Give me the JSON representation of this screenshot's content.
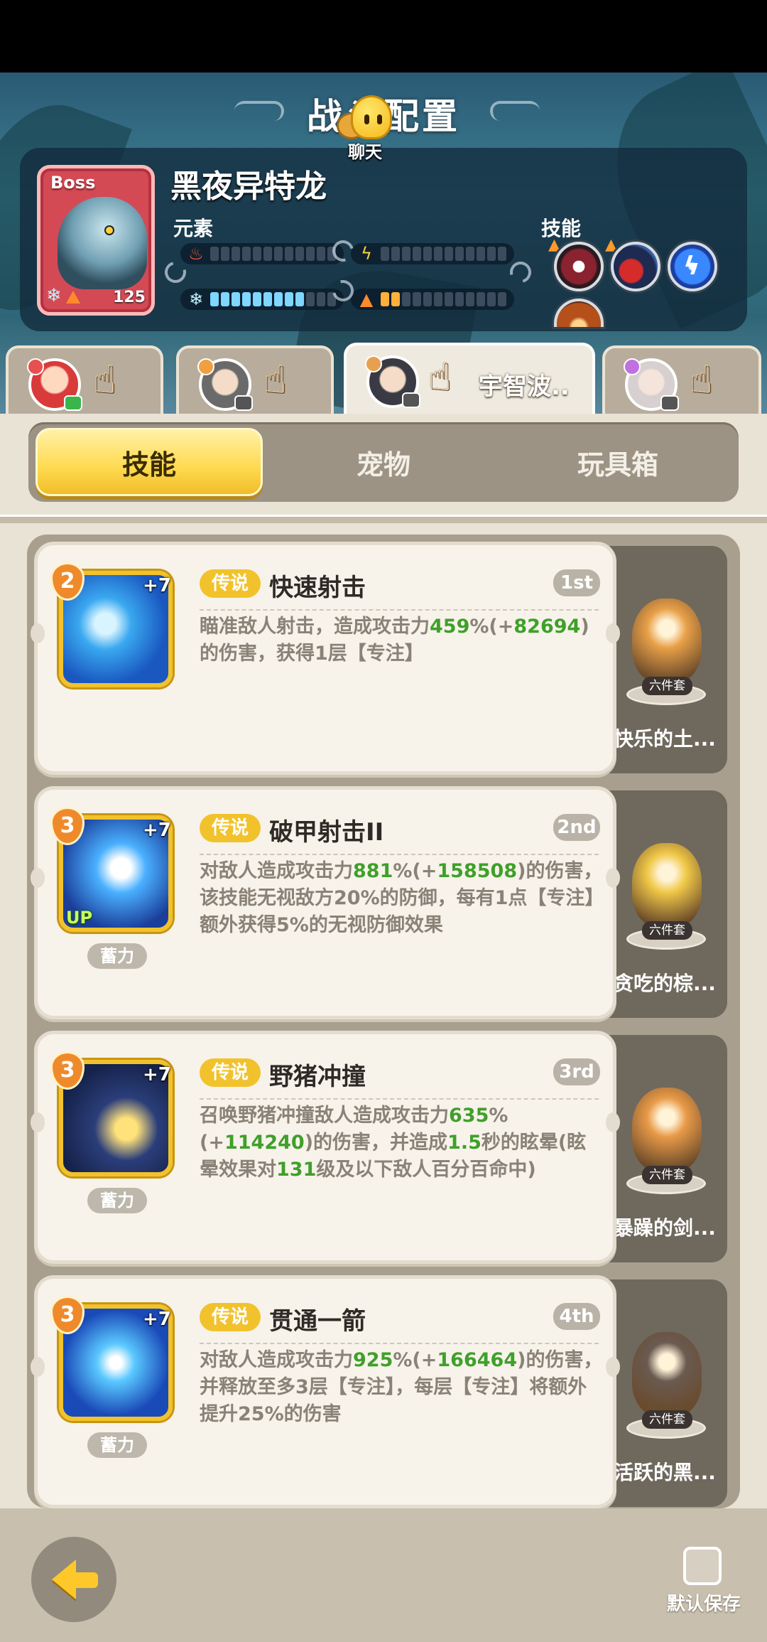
{
  "header": {
    "title": "战斗配置",
    "chat_label": "聊天"
  },
  "boss": {
    "tag": "Boss",
    "name": "黑夜异特龙",
    "level": "125",
    "element_label": "元素",
    "skill_label": "技能",
    "elements": [
      {
        "icon": "fire-icon",
        "color": "#ff5a3a",
        "filled": 0
      },
      {
        "icon": "lightning-icon",
        "color": "#ffd23a",
        "filled": 0
      },
      {
        "icon": "snowflake-icon",
        "color": "#bdf1ff",
        "filled": 9
      },
      {
        "icon": "earth-triangle-icon",
        "color": "#ff8a2a",
        "filled": 2
      }
    ],
    "skills": [
      "fanged-mouth-skill-icon",
      "red-bird-skill-icon",
      "lightning-orb-skill-icon",
      "fire-fan-skill-icon"
    ]
  },
  "team_tabs": [
    {
      "name": "",
      "active": false
    },
    {
      "name": "",
      "active": false
    },
    {
      "name": "宇智波..",
      "active": true
    },
    {
      "name": "",
      "active": false
    }
  ],
  "segments": {
    "skill": "技能",
    "pet": "宠物",
    "toybox": "玩具箱"
  },
  "skills": [
    {
      "level": "2",
      "plus": "+7",
      "rarity": "传说",
      "name": "快速射击",
      "order": "1st",
      "desc_parts": [
        "瞄准敌人射击，造成攻击力",
        "459",
        "%(+",
        "82694",
        ")的伤害，获得1层【专注】"
      ],
      "charge": "",
      "up": "",
      "pet": {
        "set": "六件套",
        "name": "快乐的土..."
      }
    },
    {
      "level": "3",
      "plus": "+7",
      "rarity": "传说",
      "name": "破甲射击II",
      "order": "2nd",
      "desc_parts": [
        "对敌人造成攻击力",
        "881",
        "%(+",
        "158508",
        ")的伤害，该技能无视敌方20%的防御，每有1点【专注】额外获得5%的无视防御效果"
      ],
      "charge": "蓄力",
      "up": "UP",
      "pet": {
        "set": "六件套",
        "name": "贪吃的棕..."
      }
    },
    {
      "level": "3",
      "plus": "+7",
      "rarity": "传说",
      "name": "野猪冲撞",
      "order": "3rd",
      "desc_parts": [
        "召唤野猪冲撞敌人造成攻击力",
        "635",
        "%(+",
        "114240",
        ")的伤害，并造成",
        "1.5",
        "秒的眩晕(眩晕效果对",
        "131",
        "级及以下敌人百分百命中)"
      ],
      "charge": "蓄力",
      "up": "",
      "pet": {
        "set": "六件套",
        "name": "暴躁的剑..."
      }
    },
    {
      "level": "3",
      "plus": "+7",
      "rarity": "传说",
      "name": "贯通一箭",
      "order": "4th",
      "desc_parts": [
        "对敌人造成攻击力",
        "925",
        "%(+",
        "166464",
        ")的伤害，并释放至多3层【专注】，每层【专注】将额外提升25%的伤害"
      ],
      "charge": "蓄力",
      "up": "",
      "pet": {
        "set": "六件套",
        "name": "活跃的黑..."
      }
    }
  ],
  "footer": {
    "save_label": "默认保存"
  }
}
